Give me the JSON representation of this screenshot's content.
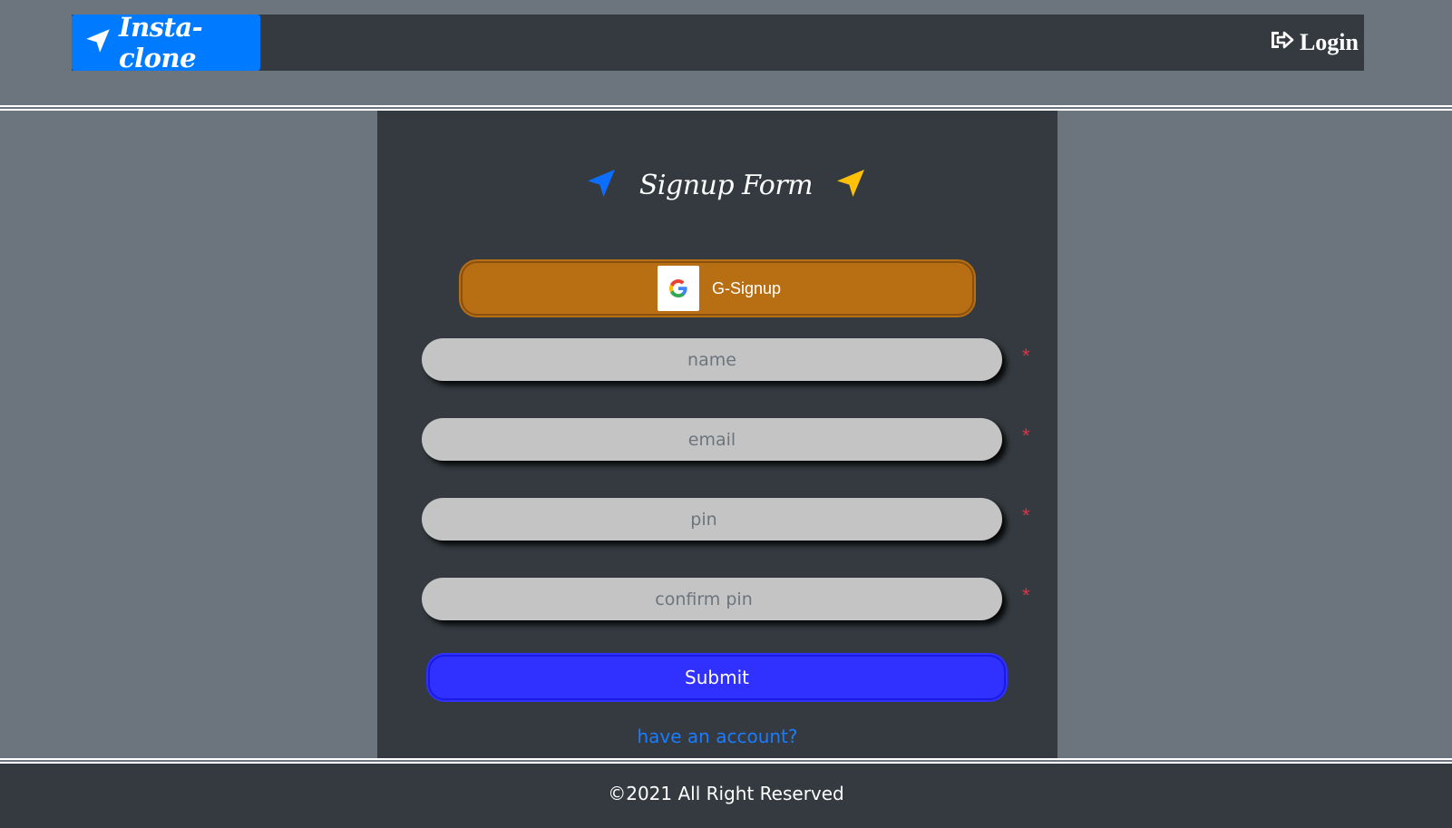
{
  "colors": {
    "page_bg": "#6c757d",
    "nav_bg": "#343a40",
    "brand_bg": "#007bff",
    "google_button": "#b86e12",
    "submit_button": "#3030ff",
    "link": "#1a7cff",
    "required": "#dc3545",
    "title_icon_left": "#0d6efd",
    "title_icon_right": "#ffc107"
  },
  "navbar": {
    "brand": {
      "icon": "location-arrow-icon",
      "label": "Insta-clone"
    },
    "login": {
      "icon": "sign-in-icon",
      "label": "Login"
    }
  },
  "form": {
    "title": "Signup Form",
    "title_icons": [
      "location-arrow-icon",
      "location-arrow-icon"
    ],
    "google_button": {
      "icon": "google-logo-icon",
      "label": "G-Signup"
    },
    "fields": [
      {
        "name": "name",
        "placeholder": "name",
        "value": "",
        "required_mark": "*"
      },
      {
        "name": "email",
        "placeholder": "email",
        "value": "",
        "required_mark": "*"
      },
      {
        "name": "pin",
        "placeholder": "pin",
        "value": "",
        "required_mark": "*"
      },
      {
        "name": "confirm_pin",
        "placeholder": "confirm pin",
        "value": "",
        "required_mark": "*"
      }
    ],
    "submit_label": "Submit",
    "have_account_link": "have an account?"
  },
  "footer": {
    "text": "©2021 All Right Reserved"
  }
}
